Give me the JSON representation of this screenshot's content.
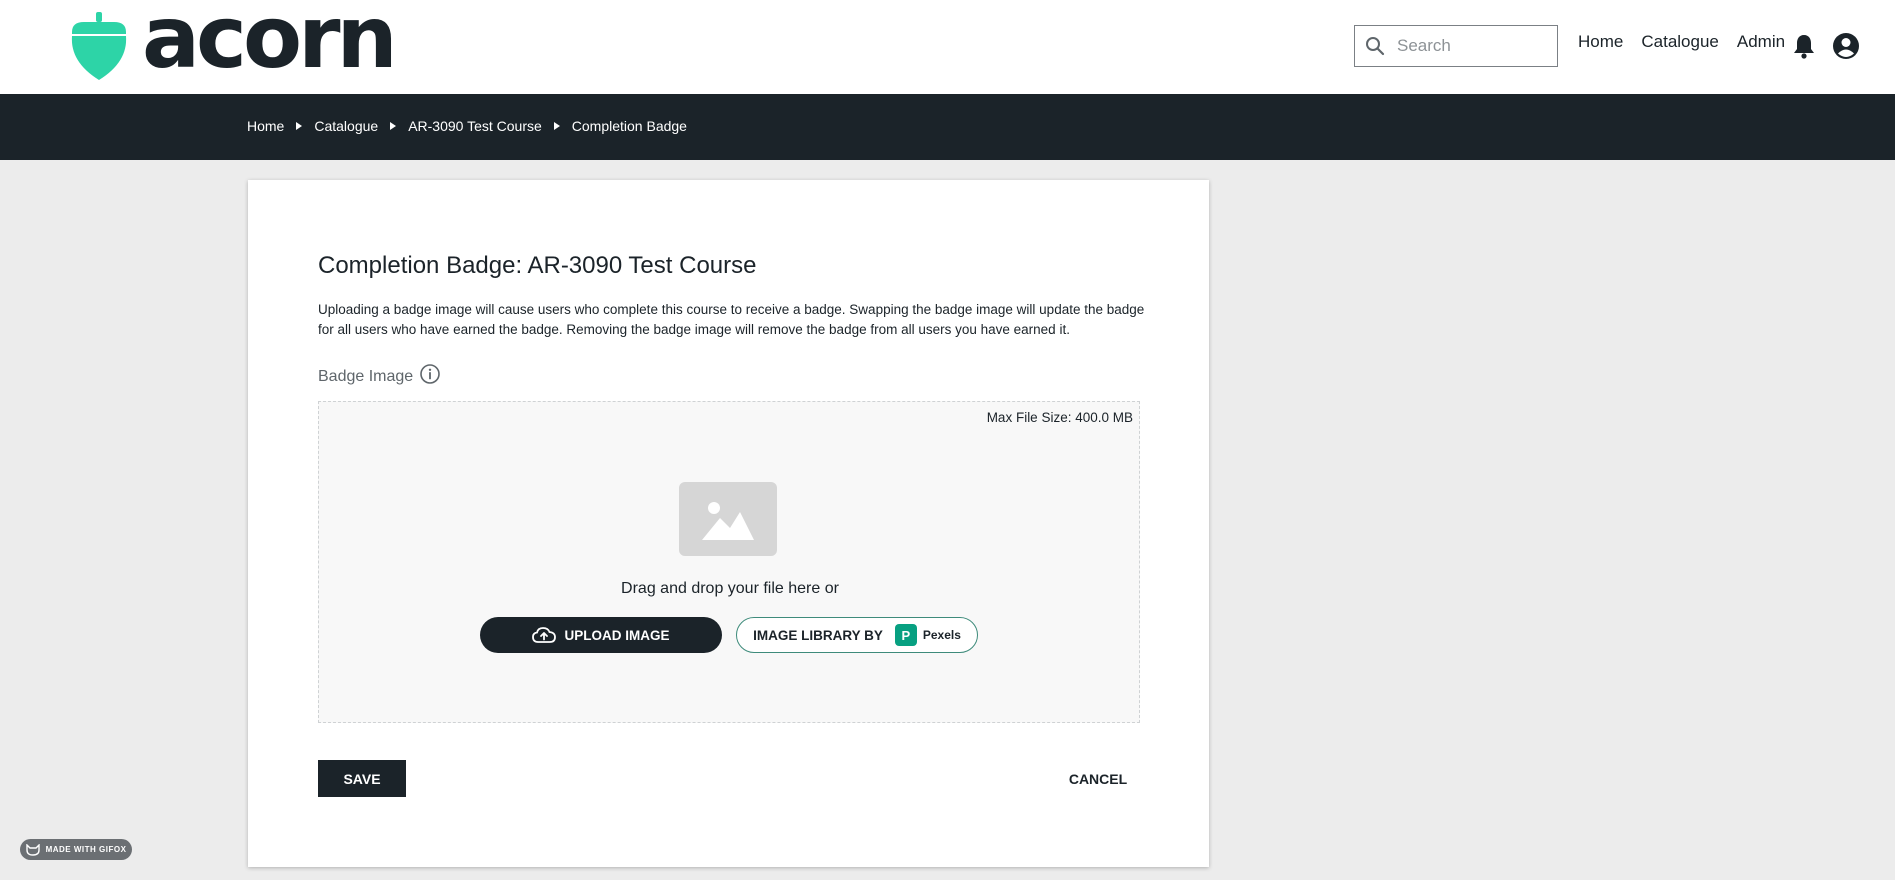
{
  "brand": {
    "name": "acorn",
    "accent": "#2dd4a7",
    "dark": "#1b2329"
  },
  "header": {
    "search": {
      "placeholder": "Search",
      "value": ""
    },
    "nav": [
      {
        "label": "Home"
      },
      {
        "label": "Catalogue"
      },
      {
        "label": "Admin"
      }
    ],
    "icons": [
      "bell-icon",
      "account-icon"
    ]
  },
  "breadcrumb": [
    {
      "label": "Home"
    },
    {
      "label": "Catalogue"
    },
    {
      "label": "AR-3090 Test Course"
    },
    {
      "label": "Completion Badge"
    }
  ],
  "page": {
    "title": "Completion Badge: AR-3090 Test Course",
    "description": "Uploading a badge image will cause users who complete this course to receive a badge. Swapping the badge image will update the badge for all users who have earned the badge. Removing the badge image will remove the badge from all users you have earned it.",
    "field_label": "Badge Image",
    "dropzone": {
      "max_size": "Max File Size: 400.0 MB",
      "drop_text": "Drag and drop your file here or",
      "upload_label": "UPLOAD IMAGE",
      "library_label": "IMAGE LIBRARY BY",
      "library_brand": "Pexels"
    },
    "save_label": "SAVE",
    "cancel_label": "CANCEL"
  },
  "watermark": {
    "label": "MADE WITH GIFOX"
  }
}
